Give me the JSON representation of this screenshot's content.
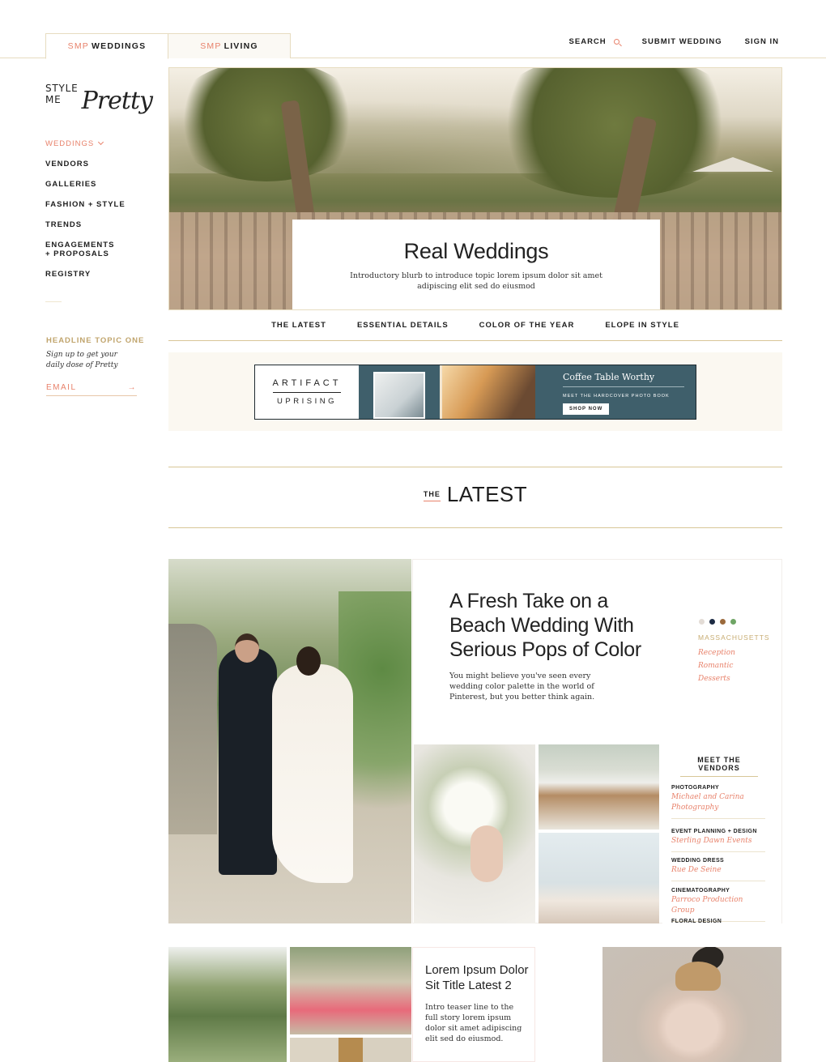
{
  "site_tabs": [
    {
      "prefix": "SMP",
      "label": "WEDDINGS"
    },
    {
      "prefix": "SMP",
      "label": "LIVING"
    }
  ],
  "top_links": {
    "search": "SEARCH",
    "submit": "SUBMIT WEDDING",
    "signin": "SIGN IN"
  },
  "logo": {
    "small": "STYLE ME",
    "script": "Pretty"
  },
  "sidebar": {
    "items": [
      {
        "label": "WEDDINGS"
      },
      {
        "label": "VENDORS"
      },
      {
        "label": "GALLERIES"
      },
      {
        "label": "FASHION + STYLE"
      },
      {
        "label": "TRENDS"
      },
      {
        "label": "ENGAGEMENTS + PROPOSALS"
      },
      {
        "label": "REGISTRY"
      }
    ],
    "newsletter": {
      "title": "HEADLINE TOPIC ONE",
      "copy": "Sign up to get your daily dose of Pretty",
      "placeholder": "EMAIL"
    }
  },
  "hero": {
    "title": "Real Weddings",
    "blurb": "Introductory blurb to introduce topic lorem ipsum dolor sit amet adipiscing elit sed do eiusmod"
  },
  "subnav": [
    "THE LATEST",
    "ESSENTIAL DETAILS",
    "COLOR OF THE YEAR",
    "ELOPE IN STYLE"
  ],
  "ad": {
    "brand_line1": "ARTIFACT",
    "brand_line2": "UPRISING",
    "headline": "Coffee Table Worthy",
    "subline": "MEET THE HARDCOVER PHOTO BOOK",
    "cta": "SHOP NOW"
  },
  "latest": {
    "the": "THE",
    "big": "LATEST"
  },
  "feature": {
    "title": "A Fresh Take on a Beach Wedding With Serious Pops of Color",
    "desc": "You might believe you've seen every wedding color palette in the world of Pinterest, but you better think again.",
    "palette": [
      "#e3dcd6",
      "#1d2b44",
      "#9b6a3c",
      "#6fa565"
    ],
    "location": "MASSACHUSETTS",
    "tags": [
      "Reception",
      "Romantic",
      "Desserts"
    ],
    "vendors_heading": "MEET THE VENDORS",
    "vendors": [
      {
        "role": "PHOTOGRAPHY",
        "name": "Michael and Carina Photography"
      },
      {
        "role": "EVENT PLANNING + DESIGN",
        "name": "Sterling Dawn Events"
      },
      {
        "role": "WEDDING DRESS",
        "name": "Rue De Seine"
      },
      {
        "role": "CINEMATOGRAPHY",
        "name": "Parroco Production Group"
      },
      {
        "role": "FLORAL DESIGN",
        "name": ""
      }
    ]
  },
  "story2": {
    "title": "Lorem Ipsum Dolor Sit Title Latest 2",
    "desc": "Intro teaser line to the full story lorem ipsum dolor sit amet adipiscing elit sed do eiusmod."
  }
}
